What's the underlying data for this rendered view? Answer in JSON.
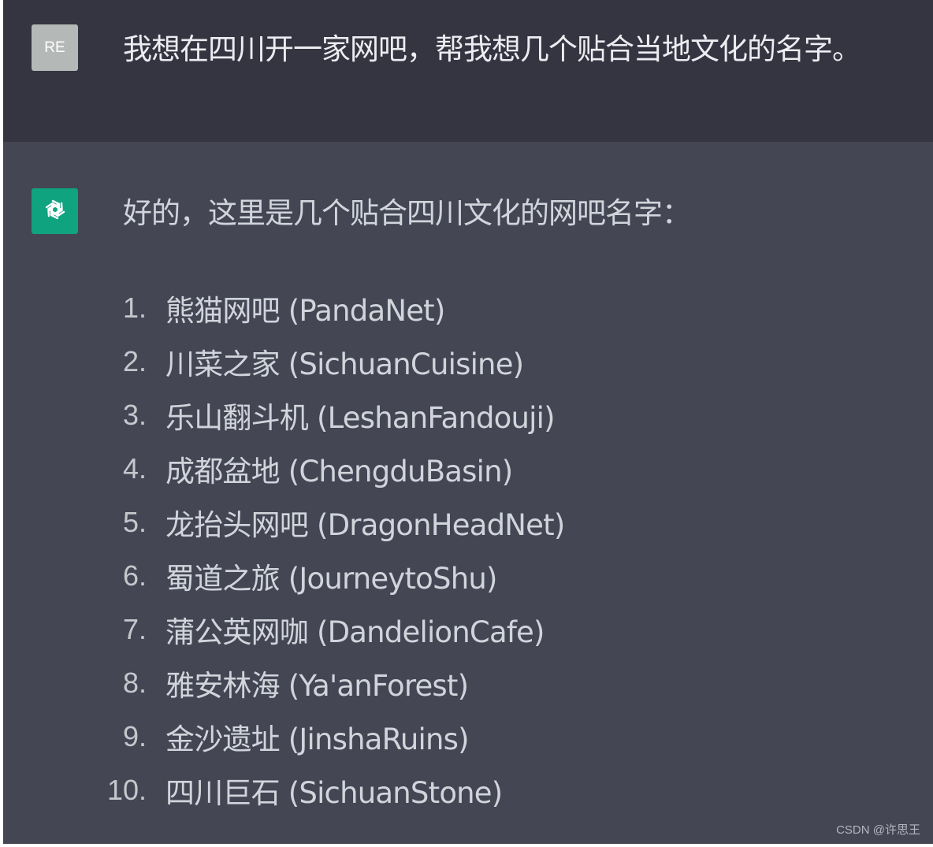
{
  "user": {
    "avatar_label": "RE",
    "message": "我想在四川开一家网吧，帮我想几个贴合当地文化的名字。"
  },
  "assistant": {
    "avatar_icon": "openai-logo-icon",
    "intro": "好的，这里是几个贴合四川文化的网吧名字：",
    "items": [
      {
        "num": "1.",
        "text": "熊猫网吧 (PandaNet)"
      },
      {
        "num": "2.",
        "text": "川菜之家 (SichuanCuisine)"
      },
      {
        "num": "3.",
        "text": "乐山翻斗机 (LeshanFandouji)"
      },
      {
        "num": "4.",
        "text": "成都盆地 (ChengduBasin)"
      },
      {
        "num": "5.",
        "text": "龙抬头网吧 (DragonHeadNet)"
      },
      {
        "num": "6.",
        "text": "蜀道之旅 (JourneytoShu)"
      },
      {
        "num": "7.",
        "text": "蒲公英网咖 (DandelionCafe)"
      },
      {
        "num": "8.",
        "text": "雅安林海 (Ya'anForest)"
      },
      {
        "num": "9.",
        "text": "金沙遗址 (JinshaRuins)"
      },
      {
        "num": "10.",
        "text": "四川巨石 (SichuanStone)"
      }
    ]
  },
  "watermark": "CSDN @许思王",
  "colors": {
    "user_bg": "#343541",
    "assistant_bg": "#444654",
    "assistant_avatar": "#10a37f",
    "user_avatar": "#b4b8b6",
    "text": "#d1d5db"
  }
}
